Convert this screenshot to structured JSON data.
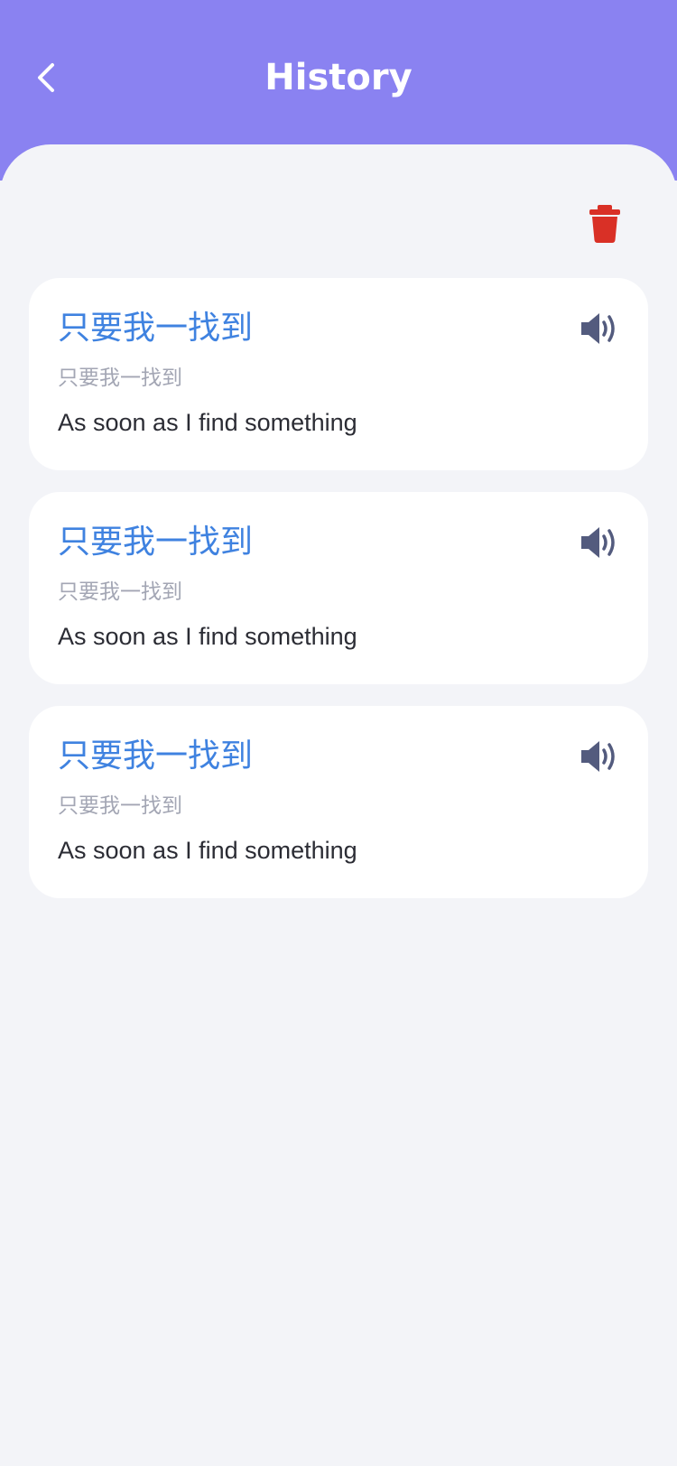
{
  "header": {
    "title": "History",
    "back_icon": "chevron-left-icon",
    "background": "#8a82f1"
  },
  "toolbar": {
    "clear_icon": "trash-icon",
    "clear_color": "#d93026"
  },
  "history": [
    {
      "source": "只要我一找到",
      "pinyin": "只要我一找到",
      "translation": "As soon as I find something",
      "speak_icon": "speaker-icon"
    },
    {
      "source": "只要我一找到",
      "pinyin": "只要我一找到",
      "translation": "As soon as I find something",
      "speak_icon": "speaker-icon"
    },
    {
      "source": "只要我一找到",
      "pinyin": "只要我一找到",
      "translation": "As soon as I find something",
      "speak_icon": "speaker-icon"
    }
  ],
  "colors": {
    "source_text": "#3f82e0",
    "secondary_text": "#a3a6b4",
    "translation_text": "#2b2c34",
    "speaker": "#535b7e",
    "page_background": "#f3f4f8"
  }
}
